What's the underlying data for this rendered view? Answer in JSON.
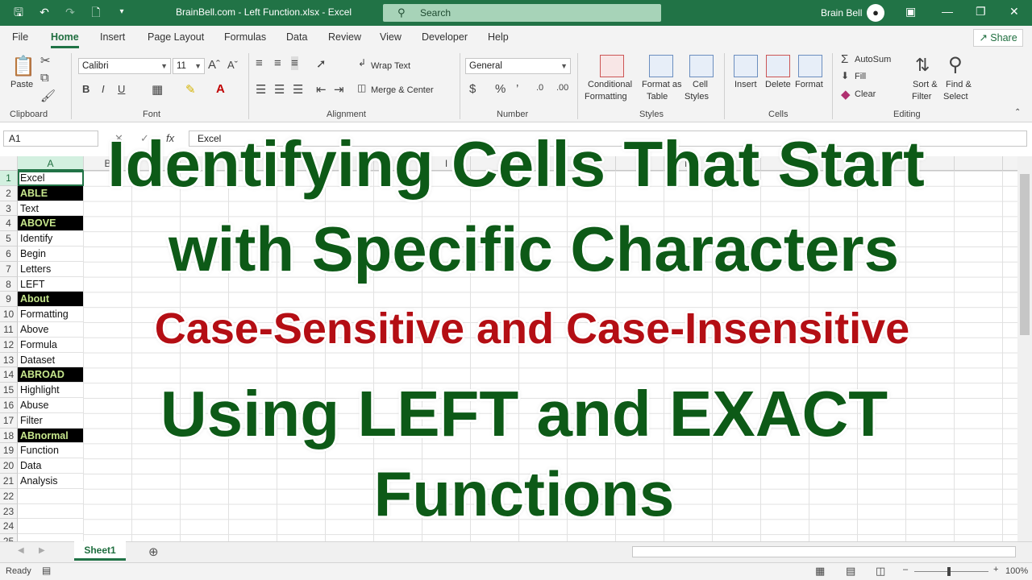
{
  "window": {
    "filename": "BrainBell.com - Left Function.xlsx - Excel",
    "search_placeholder": "Search",
    "user": "Brain Bell"
  },
  "menu": {
    "tabs": [
      "File",
      "Home",
      "Insert",
      "Page Layout",
      "Formulas",
      "Data",
      "Review",
      "View",
      "Developer",
      "Help"
    ],
    "active": "Home",
    "share": "Share"
  },
  "ribbon": {
    "clipboard": {
      "label": "Clipboard",
      "paste": "Paste"
    },
    "font": {
      "label": "Font",
      "name": "Calibri",
      "size": "11"
    },
    "alignment": {
      "label": "Alignment",
      "wrap_text": "Wrap Text",
      "merge_center": "Merge & Center"
    },
    "number": {
      "label": "Number",
      "format": "General"
    },
    "styles": {
      "label": "Styles",
      "conditional": "Conditional",
      "conditional2": "Formatting",
      "format_as": "Format as",
      "format_as2": "Table",
      "cell": "Cell",
      "cell2": "Styles"
    },
    "cells": {
      "label": "Cells",
      "insert": "Insert",
      "delete": "Delete",
      "format": "Format"
    },
    "editing": {
      "label": "Editing",
      "autosum": "AutoSum",
      "fill": "Fill",
      "clear": "Clear",
      "sort": "Sort &",
      "sort2": "Filter",
      "find": "Find &",
      "find2": "Select"
    }
  },
  "formula_bar": {
    "name_box": "A1",
    "content": "Excel"
  },
  "columns": [
    "A",
    "B",
    "I",
    "M",
    "N"
  ],
  "cells": [
    {
      "row": "1",
      "value": "Excel",
      "highlight": false
    },
    {
      "row": "2",
      "value": "ABLE",
      "highlight": true
    },
    {
      "row": "3",
      "value": "Text",
      "highlight": false
    },
    {
      "row": "4",
      "value": "ABOVE",
      "highlight": true
    },
    {
      "row": "5",
      "value": "Identify",
      "highlight": false
    },
    {
      "row": "6",
      "value": "Begin",
      "highlight": false
    },
    {
      "row": "7",
      "value": "Letters",
      "highlight": false
    },
    {
      "row": "8",
      "value": "LEFT",
      "highlight": false
    },
    {
      "row": "9",
      "value": "About",
      "highlight": true
    },
    {
      "row": "10",
      "value": "Formatting",
      "highlight": false
    },
    {
      "row": "11",
      "value": "Above",
      "highlight": false
    },
    {
      "row": "12",
      "value": "Formula",
      "highlight": false
    },
    {
      "row": "13",
      "value": "Dataset",
      "highlight": false
    },
    {
      "row": "14",
      "value": "ABROAD",
      "highlight": true
    },
    {
      "row": "15",
      "value": "Highlight",
      "highlight": false
    },
    {
      "row": "16",
      "value": "Abuse",
      "highlight": false
    },
    {
      "row": "17",
      "value": "Filter",
      "highlight": false
    },
    {
      "row": "18",
      "value": "ABnormal",
      "highlight": true
    },
    {
      "row": "19",
      "value": "Function",
      "highlight": false
    },
    {
      "row": "20",
      "value": "Data",
      "highlight": false
    },
    {
      "row": "21",
      "value": "Analysis",
      "highlight": false
    },
    {
      "row": "22",
      "value": "",
      "highlight": false
    },
    {
      "row": "23",
      "value": "",
      "highlight": false
    },
    {
      "row": "24",
      "value": "",
      "highlight": false
    },
    {
      "row": "25",
      "value": "",
      "highlight": false
    }
  ],
  "sheet": {
    "tab": "Sheet1"
  },
  "status": {
    "ready": "Ready",
    "zoom": "100%"
  },
  "overlay": {
    "line1": "Identifying Cells That Start",
    "line2": "with Specific Characters",
    "line3": "Case-Sensitive and Case-Insensitive",
    "line4": "Using LEFT and EXACT",
    "line5": "Functions"
  },
  "colors": {
    "accent": "#217346",
    "overlay_green": "#0d5a17",
    "overlay_red": "#b40e14",
    "highlight_text": "#c6e68c"
  }
}
